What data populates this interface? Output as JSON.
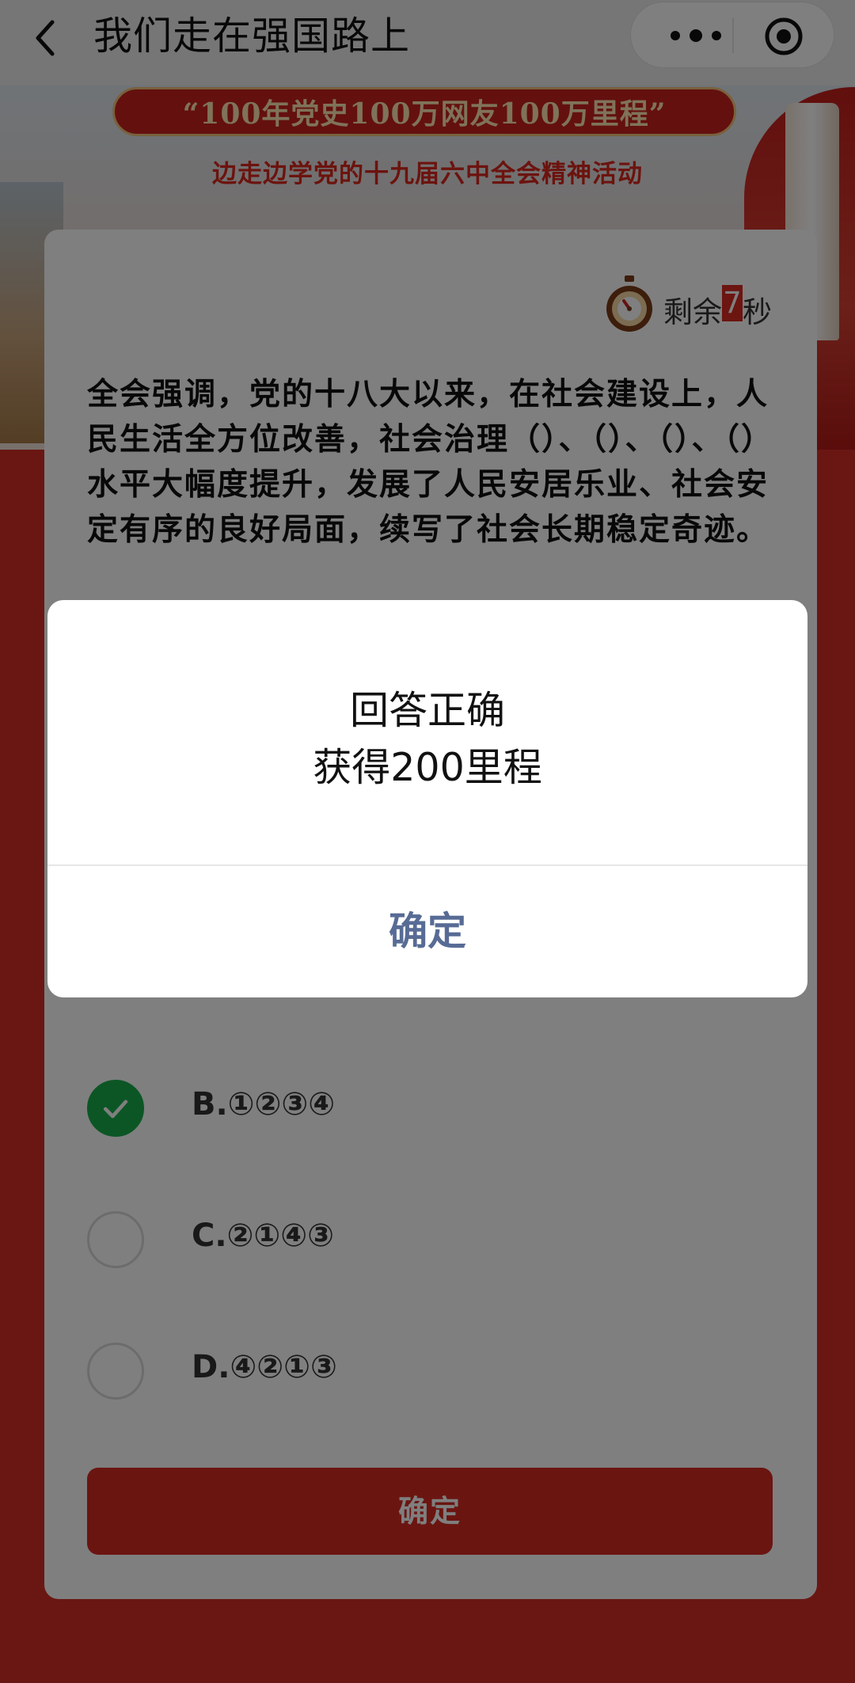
{
  "navbar": {
    "title": "我们走在强国路上",
    "back_icon": "chevron-left-icon",
    "more_icon": "more-dots-icon",
    "close_icon": "target-close-icon"
  },
  "banner": {
    "slogan": "“100年党史100万网友100万里程”",
    "subslogan": "边走边学党的十九届六中全会精神活动"
  },
  "quiz": {
    "timer": {
      "prefix": "剩余",
      "seconds": "7",
      "suffix": "秒",
      "icon": "stopwatch-icon"
    },
    "question": "全会强调，党的十八大以来，在社会建设上，人民生活全方位改善，社会治理（）、（）、（）、（）水平大幅度提升，发展了人民安居乐业、社会安定有序的良好局面，续写了社会长期稳定奇迹。",
    "options": [
      {
        "label": "",
        "checked": false
      },
      {
        "label": "B.①②③④",
        "checked": true
      },
      {
        "label": "C.②①④③",
        "checked": false
      },
      {
        "label": "D.④②①③",
        "checked": false
      }
    ],
    "submit_label": "确定"
  },
  "dialog": {
    "title": "回答正确",
    "message": "获得200里程",
    "confirm_label": "确定"
  },
  "colors": {
    "brand_red": "#d72b22",
    "correct_green": "#19ad4a",
    "dialog_button": "#576b95"
  }
}
